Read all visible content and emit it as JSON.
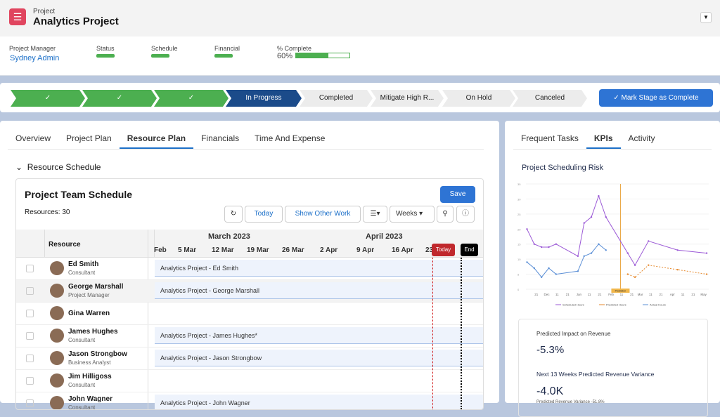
{
  "header": {
    "object_type": "Project",
    "title": "Analytics Project",
    "logo_icon": "clipboard-icon",
    "fields": [
      {
        "label": "Project Manager",
        "value": "Sydney Admin"
      },
      {
        "label": "Status"
      },
      {
        "label": "Schedule"
      },
      {
        "label": "Financial"
      },
      {
        "label": "% Complete",
        "value": "60%",
        "progress": 0.6
      }
    ]
  },
  "path": {
    "stages": [
      "✓",
      "✓",
      "✓",
      "In Progress",
      "Completed",
      "Mitigate High R...",
      "On Hold",
      "Canceled"
    ],
    "mark_button": "✓  Mark Stage as Complete"
  },
  "tabs": [
    "Overview",
    "Project Plan",
    "Resource Plan",
    "Financials",
    "Time And Expense"
  ],
  "section": "Resource Schedule",
  "schedule": {
    "title": "Project Team Schedule",
    "resources": "Resources: 30",
    "save": "Save",
    "today": "Today",
    "show_other": "Show Other Work",
    "weeks": "Weeks",
    "col_resource": "Resource",
    "months": [
      "March 2023",
      "April 2023"
    ],
    "weeks_list": [
      "Feb",
      "5 Mar",
      "12 Mar",
      "19 Mar",
      "26 Mar",
      "2 Apr",
      "9 Apr",
      "16 Apr",
      "23"
    ],
    "today_marker": "Today",
    "end_marker": "End",
    "rows": [
      {
        "name": "Ed Smith",
        "role": "Consultant",
        "bar": "Analytics Project - Ed Smith"
      },
      {
        "name": "George Marshall",
        "role": "Project Manager",
        "bar": "Analytics Project - George Marshall"
      },
      {
        "name": "Gina Warren",
        "role": "",
        "bar": ""
      },
      {
        "name": "James Hughes",
        "role": "Consultant",
        "bar": "Analytics Project - James Hughes*"
      },
      {
        "name": "Jason Strongbow",
        "role": "Business Analyst",
        "bar": "Analytics Project - Jason Strongbow"
      },
      {
        "name": "Jim Hilligoss",
        "role": "Consultant",
        "bar": ""
      },
      {
        "name": "John Wagner",
        "role": "Consultant",
        "bar": "Analytics Project - John Wagner"
      }
    ]
  },
  "side": {
    "tabs": [
      "Frequent Tasks",
      "KPIs",
      "Activity"
    ],
    "kpi1_label": "Predicted Impact on Revenue",
    "kpi1_value": "-5.3%",
    "kpi2_label": "Next 13 Weeks Predicted Revenue Variance",
    "kpi2_value": "-4.0K",
    "kpi2_note": "Predicted Revenue Variance -51.8%"
  },
  "chart_data": {
    "type": "line",
    "title": "Project Scheduling Risk",
    "ylim": [
      0,
      35
    ],
    "yticks": [
      0,
      5,
      10,
      15,
      20,
      25,
      30,
      35
    ],
    "xticks": [
      {
        "d": 10,
        "l": "21"
      },
      {
        "d": 20,
        "l": "Dec"
      },
      {
        "d": 30,
        "l": "11"
      },
      {
        "d": 40,
        "l": "21"
      },
      {
        "d": 51,
        "l": "Jan"
      },
      {
        "d": 61,
        "l": "11"
      },
      {
        "d": 71,
        "l": "21"
      },
      {
        "d": 82,
        "l": "Feb"
      },
      {
        "d": 92,
        "l": "11"
      },
      {
        "d": 102,
        "l": "21"
      },
      {
        "d": 110,
        "l": "Mar"
      },
      {
        "d": 120,
        "l": "11"
      },
      {
        "d": 130,
        "l": "21"
      },
      {
        "d": 141,
        "l": "Apr"
      },
      {
        "d": 151,
        "l": "11"
      },
      {
        "d": 161,
        "l": "21"
      },
      {
        "d": 171,
        "l": "May"
      }
    ],
    "xlim": [
      0,
      176
    ],
    "prediction_at": 91,
    "prediction_label": "Prediction",
    "series": [
      {
        "name": "Scheduled Hours",
        "color": "#9b59d6",
        "dash": false,
        "points": [
          [
            1,
            20
          ],
          [
            8,
            15
          ],
          [
            15,
            14
          ],
          [
            22,
            14
          ],
          [
            29,
            15
          ],
          [
            50,
            11
          ],
          [
            56,
            22
          ],
          [
            63,
            24
          ],
          [
            70,
            31
          ],
          [
            77,
            24
          ],
          [
            98,
            12
          ],
          [
            105,
            8
          ],
          [
            118,
            16
          ],
          [
            146,
            13
          ],
          [
            174,
            12
          ]
        ]
      },
      {
        "name": "Predicted Hours",
        "color": "#e68a2e",
        "dash": true,
        "points": [
          [
            98,
            5
          ],
          [
            105,
            4
          ],
          [
            118,
            8
          ],
          [
            146,
            6.5
          ],
          [
            174,
            5
          ]
        ]
      },
      {
        "name": "Actual Hours",
        "color": "#5b8fd6",
        "dash": false,
        "points": [
          [
            1,
            9
          ],
          [
            8,
            7
          ],
          [
            15,
            4
          ],
          [
            22,
            7
          ],
          [
            29,
            5
          ],
          [
            50,
            6
          ],
          [
            56,
            11
          ],
          [
            63,
            12
          ],
          [
            70,
            15
          ],
          [
            77,
            13
          ]
        ]
      }
    ]
  }
}
